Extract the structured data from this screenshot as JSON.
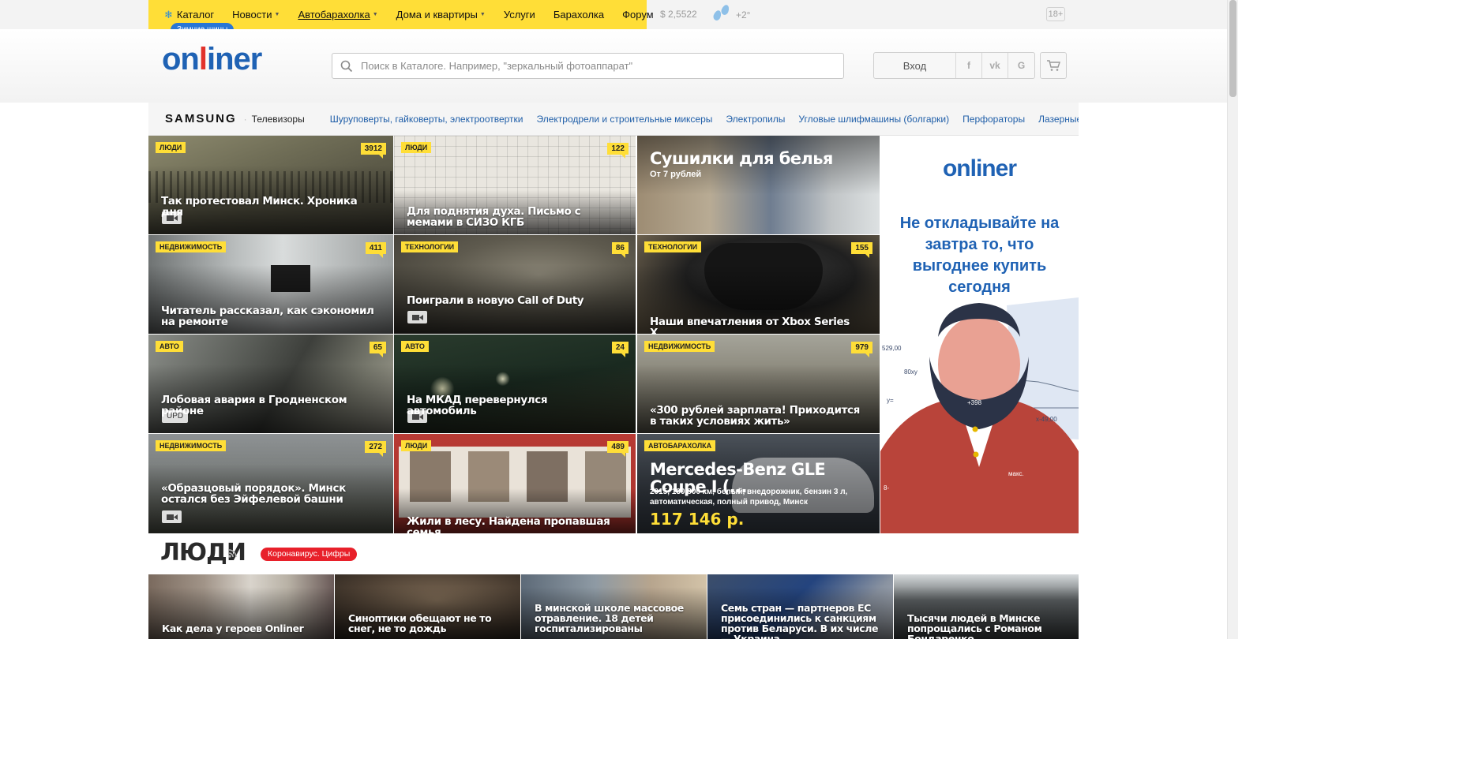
{
  "topnav": {
    "items": [
      {
        "label": "Каталог",
        "icon": "snowflake-icon",
        "dropdown": false
      },
      {
        "label": "Новости",
        "dropdown": true
      },
      {
        "label": "Автобарахолка",
        "dropdown": true,
        "underlined": true
      },
      {
        "label": "Дома и квартиры",
        "dropdown": true
      },
      {
        "label": "Услуги",
        "dropdown": false
      },
      {
        "label": "Барахолка",
        "dropdown": false
      },
      {
        "label": "Форум",
        "dropdown": false
      }
    ],
    "winter_badge": "Зимние шины",
    "rate": "$ 2,5522",
    "temperature": "+2°",
    "age_limit": "18+",
    "accent_color": "#ffde37"
  },
  "header": {
    "logo_pre": "on",
    "logo_red": "l",
    "logo_post": "iner",
    "search_placeholder": "Поиск в Каталоге. Например, \"зеркальный фотоаппарат\"",
    "login_label": "Вход",
    "social": [
      "f",
      "vk",
      "G"
    ]
  },
  "catbar": {
    "brand": "SAMSUNG",
    "brand_category": "Телевизоры",
    "links": [
      "Шуруповерты, гайковерты, электроотвертки",
      "Электродрели и строительные миксеры",
      "Электропилы",
      "Угловые шлифмашины (болгарки)",
      "Перфораторы",
      "Лазерные нив"
    ]
  },
  "tiles": [
    {
      "tag": "Люди",
      "count": "3912",
      "title": "Так протестовал Минск. Хроника дня"
    },
    {
      "tag": "Люди",
      "count": "122",
      "title": "Для поднятия духа. Письмо с мемами в СИЗО КГБ"
    },
    {
      "title": "Сушилки для белья",
      "sub": "От 7 рублей"
    },
    {
      "tag": "Недвижимость",
      "count": "411",
      "title": "Читатель рассказал, как сэкономил на ремонте"
    },
    {
      "tag": "Технологии",
      "count": "86",
      "title": "Поиграли в новую Call of Duty"
    },
    {
      "tag": "Технологии",
      "count": "155",
      "title": "Наши впечатления от Xbox Series X"
    },
    {
      "tag": "Авто",
      "count": "65",
      "title": "Лобовая авария в Гродненском районе",
      "badge": "UPD"
    },
    {
      "tag": "Авто",
      "count": "24",
      "title": "На МКАД перевернулся автомобиль"
    },
    {
      "tag": "Недвижимость",
      "count": "979",
      "title": "«300 рублей зарплата! Приходится в таких условиях жить»"
    },
    {
      "tag": "Недвижимость",
      "count": "272",
      "title": "«Образцовый порядок». Минск остался без Эйфелевой башни"
    },
    {
      "tag": "Люди",
      "count": "489",
      "title": "Жили в лесу. Найдена пропавшая семья"
    },
    {
      "tag": "Автобарахолка",
      "title": "Mercedes-Benz GLE Coupe I (...",
      "spec": "2015, 130 800 км, белый, внедорожник, бензин 3 л, автоматическая, полный привод, Минск",
      "price": "117 146 р."
    }
  ],
  "ad": {
    "logo": "onliner",
    "text": "Не откладывайте на завтра то, что выгоднее купить сегодня",
    "chart_labels": [
      "529,00",
      "80ху",
      "+398",
      "х-49,00",
      "8-",
      "у=",
      "макс."
    ]
  },
  "section": {
    "title": "ЛЮДИ",
    "badge": "Коронавирус. Цифры",
    "tiles": [
      "Как дела у героев Onliner",
      "Синоптики обещают не то снег, не то дождь",
      "В минской школе массовое отравление. 18 детей госпитализированы",
      "Семь стран — партнеров ЕС присоединились к санкциям против Беларуси. В их числе — Украина",
      "Тысячи людей в Минске попрощались с Романом Бондаренко"
    ]
  }
}
